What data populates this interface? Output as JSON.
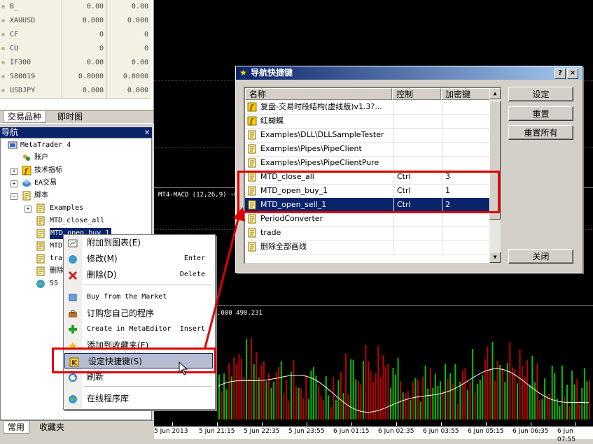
{
  "market_watch": {
    "rows": [
      {
        "symbol": "B_",
        "bid": "0.00",
        "ask": "0.00"
      },
      {
        "symbol": "XAUUSD",
        "bid": "0.000",
        "ask": "0.000"
      },
      {
        "symbol": "CF",
        "bid": "0",
        "ask": "0"
      },
      {
        "symbol": "CU",
        "bid": "0",
        "ask": "0"
      },
      {
        "symbol": "IF300",
        "bid": "0.00",
        "ask": "0.00"
      },
      {
        "symbol": "580019",
        "bid": "0.0000",
        "ask": "0.0000"
      },
      {
        "symbol": "USDJPY",
        "bid": "0.000",
        "ask": "0.000"
      }
    ],
    "tabs": [
      "交易品种",
      "即时图"
    ]
  },
  "navigator": {
    "title": "导航",
    "close": "×",
    "items": {
      "root": "MetaTrader 4",
      "accounts": "账户",
      "indicators": "技术指标",
      "experts": "EA交易",
      "scripts": "脚本",
      "examples": "Examples",
      "close_all": "MTD_close_all",
      "open_buy": "MTD_open_buy_1",
      "open_sell": "MTD",
      "trade": "tra",
      "delete": "删除",
      "s55": "55"
    },
    "bottom_tabs": [
      "常用",
      "收藏夹"
    ]
  },
  "chart": {
    "macd_label": "MT4-MACD (12,26,9) -0.1",
    "ind2_label": ".000 490.231",
    "time_ticks": [
      "5 Jun 2013",
      "5 Jun 21:15",
      "5 Jun 22:35",
      "5 Jun 23:55",
      "6 Jun 01:15",
      "6 Jun 02:35",
      "6 Jun 03:55",
      "6 Jun 05:15",
      "6 Jun 06:35",
      "6 Jun 07:55"
    ]
  },
  "dialog": {
    "title": "导航快捷键",
    "help": "?",
    "close_x": "×",
    "columns": [
      "名称",
      "控制",
      "加密键"
    ],
    "rows": [
      {
        "name": "复盘-交易时段结构(虚线版)v1.3?...",
        "ctrl": "",
        "key": ""
      },
      {
        "name": "红蝴蝶",
        "ctrl": "",
        "key": ""
      },
      {
        "name": "Examples\\DLL\\DLLSampleTester",
        "ctrl": "",
        "key": ""
      },
      {
        "name": "Examples\\Pipes\\PipeClient",
        "ctrl": "",
        "key": ""
      },
      {
        "name": "Examples\\Pipes\\PipeClientPure",
        "ctrl": "",
        "key": ""
      },
      {
        "name": "MTD_close_all",
        "ctrl": "Ctrl",
        "key": "3"
      },
      {
        "name": "MTD_open_buy_1",
        "ctrl": "Ctrl",
        "key": "1"
      },
      {
        "name": "MTD_open_sell_1",
        "ctrl": "Ctrl",
        "key": "2"
      },
      {
        "name": "PeriodConverter",
        "ctrl": "",
        "key": ""
      },
      {
        "name": "trade",
        "ctrl": "",
        "key": ""
      },
      {
        "name": "删除全部画线",
        "ctrl": "",
        "key": ""
      }
    ],
    "buttons": {
      "set": "设定",
      "reset": "重置",
      "reset_all": "重置所有",
      "close": "关闭"
    }
  },
  "context_menu": {
    "items": [
      {
        "label": "附加到图表(E)",
        "shortcut": ""
      },
      {
        "label": "修改(M)",
        "shortcut": "Enter"
      },
      {
        "label": "删除(D)",
        "shortcut": "Delete"
      },
      {
        "label": "Buy from the Market",
        "shortcut": ""
      },
      {
        "label": "订购您自己的程序",
        "shortcut": ""
      },
      {
        "label": "Create in MetaEditor",
        "shortcut": "Insert"
      },
      {
        "label": "添加到收藏夹(F)",
        "shortcut": ""
      },
      {
        "label": "设定快捷键(S)",
        "shortcut": ""
      },
      {
        "label": "刷新",
        "shortcut": ""
      },
      {
        "label": "在线程序库",
        "shortcut": ""
      }
    ]
  },
  "colors": {
    "accent": "#0a246a",
    "annotation": "#e00000",
    "bull": "#00c000",
    "bear": "#c00000"
  }
}
